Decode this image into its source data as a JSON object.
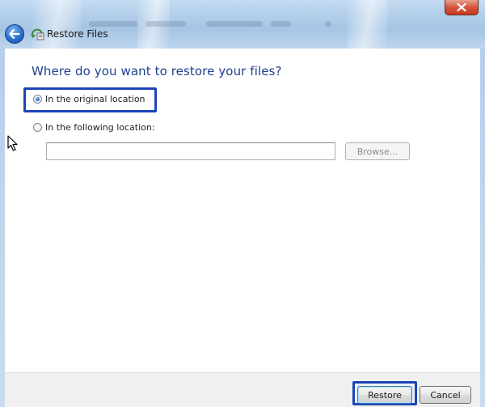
{
  "window": {
    "title": "Restore Files",
    "close_icon": "close-icon",
    "back_icon": "back-arrow-icon",
    "app_icon": "restore-files-icon"
  },
  "main": {
    "heading": "Where do you want to restore your files?",
    "options": [
      {
        "label": "In the original location",
        "selected": true
      },
      {
        "label": "In the following location:",
        "selected": false
      }
    ],
    "location_input": {
      "value": "",
      "placeholder": ""
    },
    "browse_label": "Browse..."
  },
  "footer": {
    "restore_label": "Restore",
    "cancel_label": "Cancel"
  },
  "colors": {
    "heading": "#1e3f8f",
    "highlight": "#1c44b8"
  }
}
